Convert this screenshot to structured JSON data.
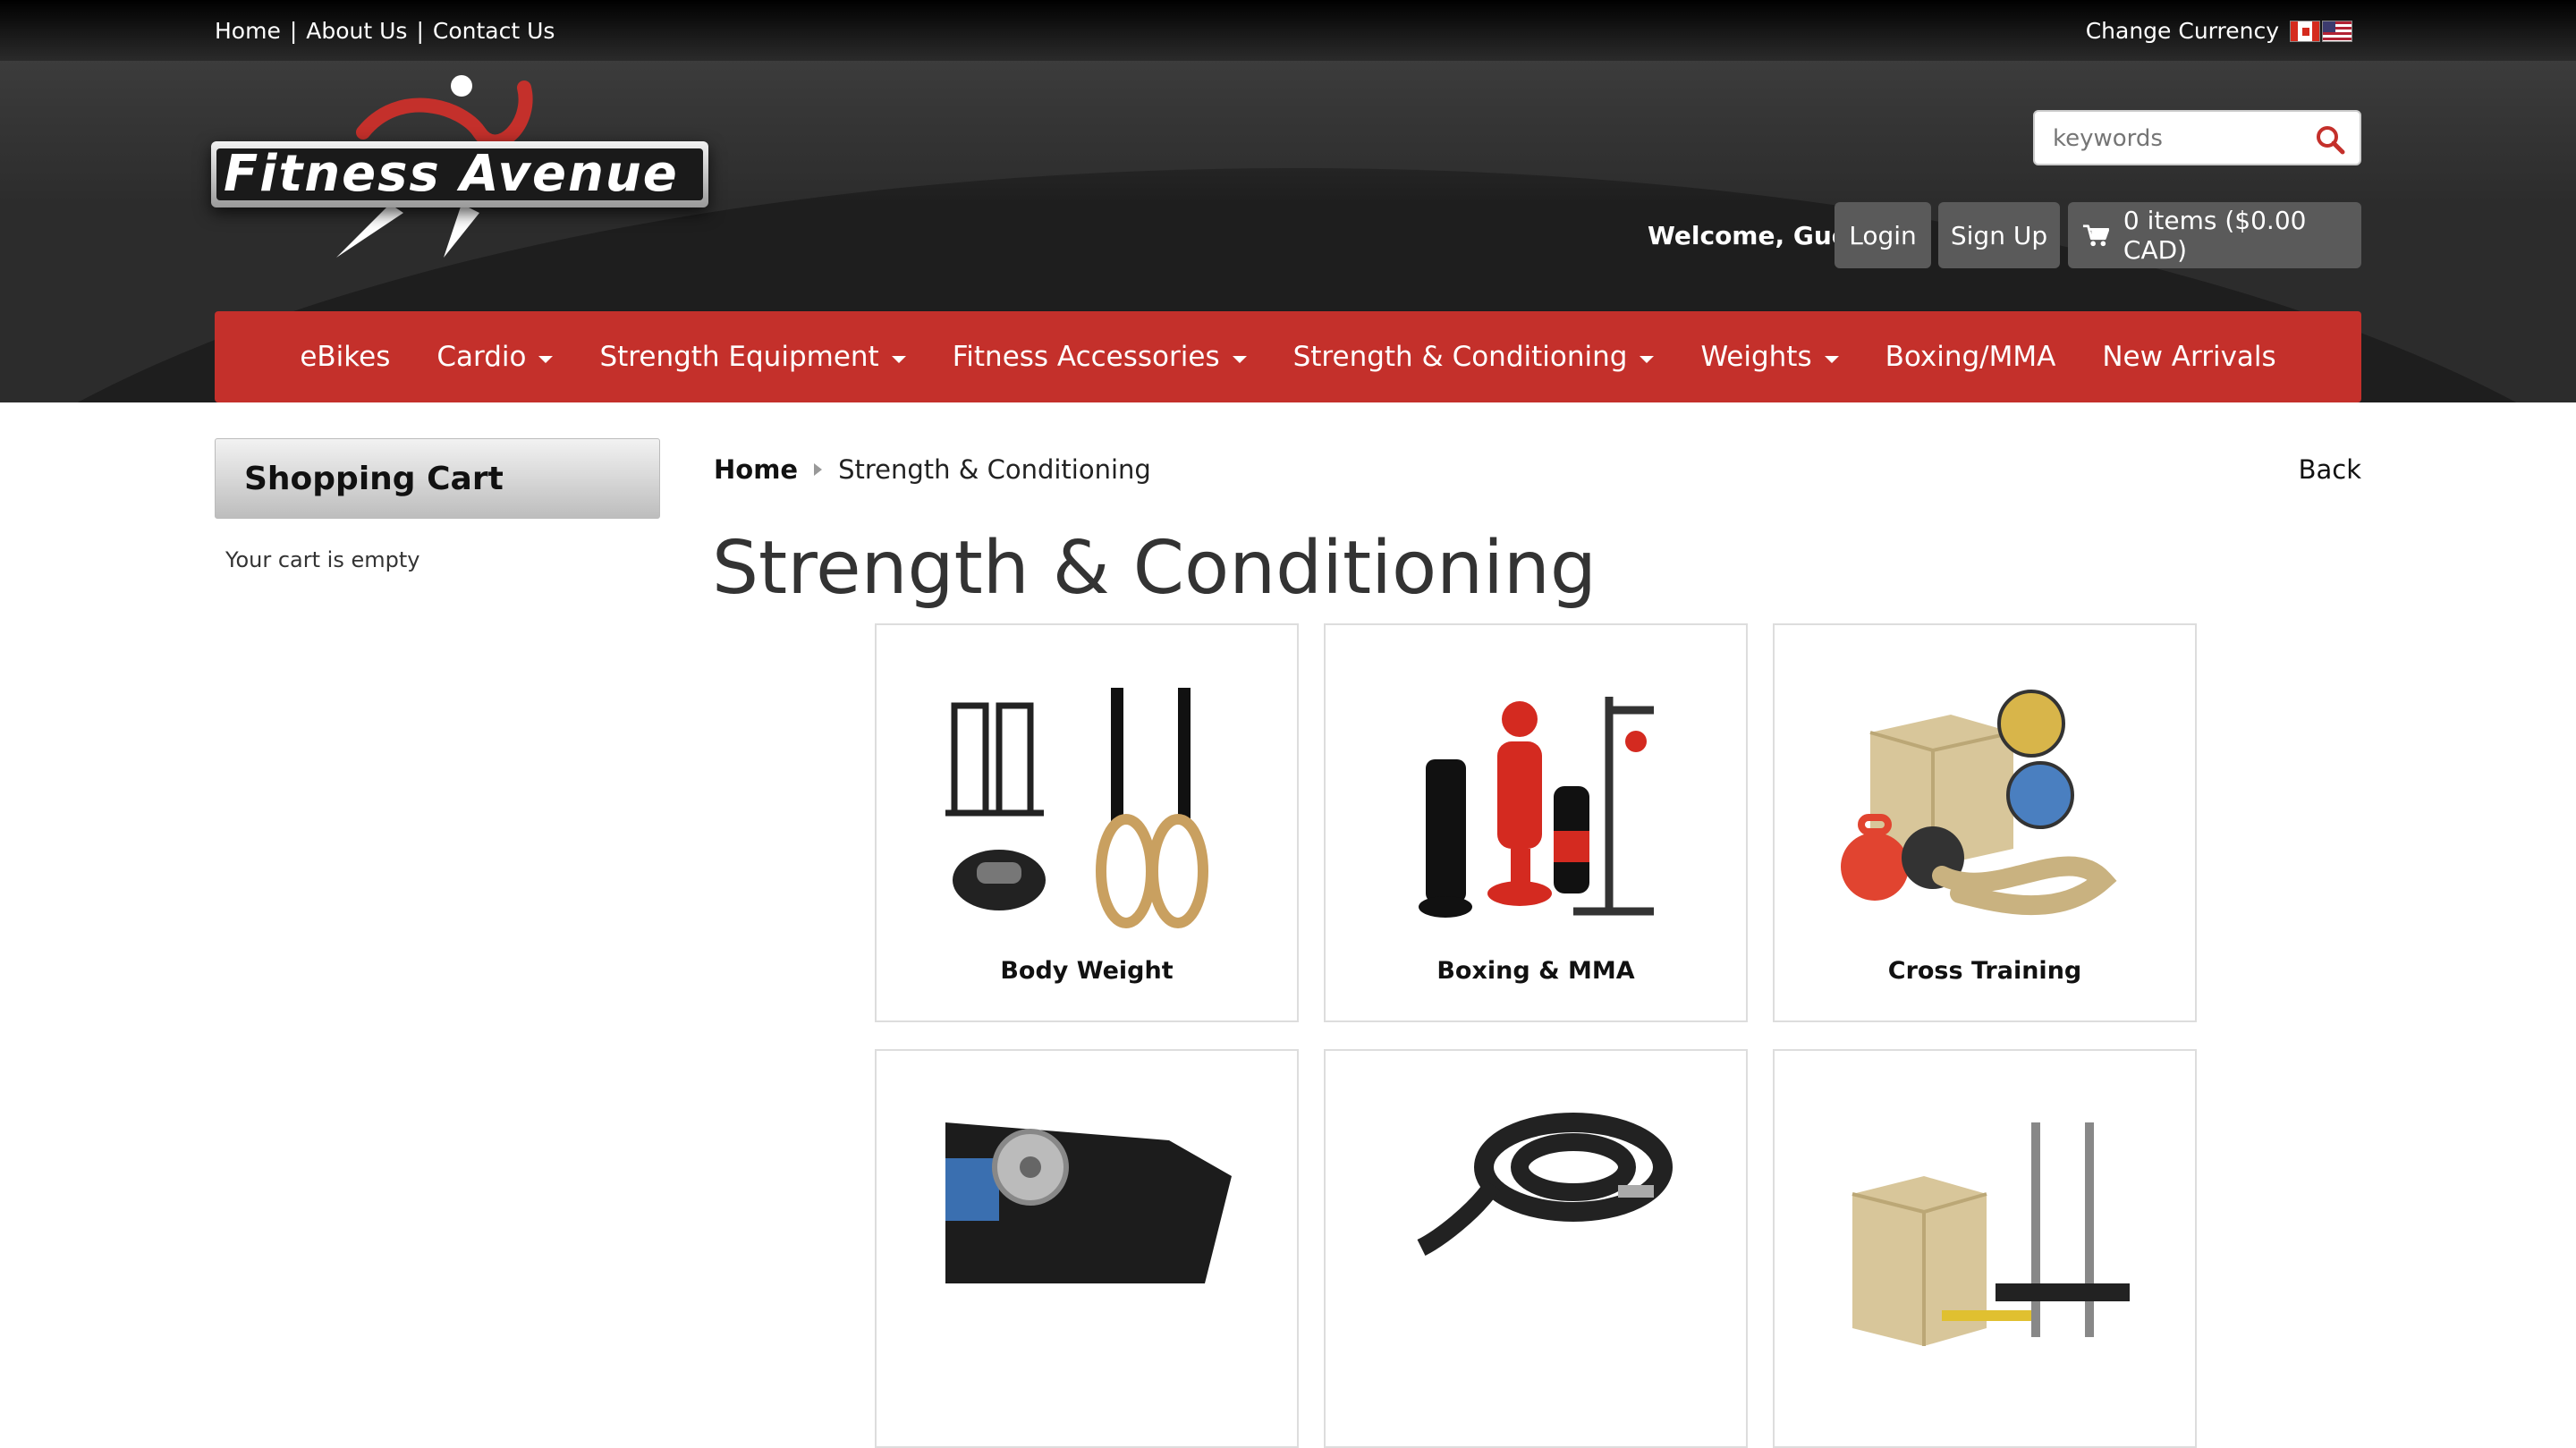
{
  "topbar": {
    "links": [
      "Home",
      "About Us",
      "Contact Us"
    ],
    "separator": "|",
    "currency_label": "Change Currency"
  },
  "header": {
    "logo_text": "Fitness Avenue",
    "search_placeholder": "keywords",
    "welcome": "Welcome, Guest",
    "login_label": "Login",
    "signup_label": "Sign Up",
    "cart_label": "0 items ($0.00 CAD)"
  },
  "nav": {
    "items": [
      {
        "label": "eBikes",
        "dropdown": false
      },
      {
        "label": "Cardio",
        "dropdown": true
      },
      {
        "label": "Strength Equipment",
        "dropdown": true
      },
      {
        "label": "Fitness Accessories",
        "dropdown": true
      },
      {
        "label": "Strength & Conditioning",
        "dropdown": true
      },
      {
        "label": "Weights",
        "dropdown": true
      },
      {
        "label": "Boxing/MMA",
        "dropdown": false
      },
      {
        "label": "New Arrivals",
        "dropdown": false
      }
    ]
  },
  "sidebar": {
    "title": "Shopping Cart",
    "empty_text": "Your cart is empty"
  },
  "breadcrumb": {
    "home": "Home",
    "current": "Strength & Conditioning"
  },
  "back_label": "Back",
  "page_title": "Strength & Conditioning",
  "categories": [
    {
      "label": "Body Weight"
    },
    {
      "label": "Boxing & MMA"
    },
    {
      "label": "Cross Training"
    },
    {
      "label": ""
    },
    {
      "label": ""
    },
    {
      "label": ""
    }
  ],
  "colors": {
    "nav_red": "#c4302b",
    "button_gray": "#5a5a5a",
    "header_dark": "#2c2c2c"
  }
}
